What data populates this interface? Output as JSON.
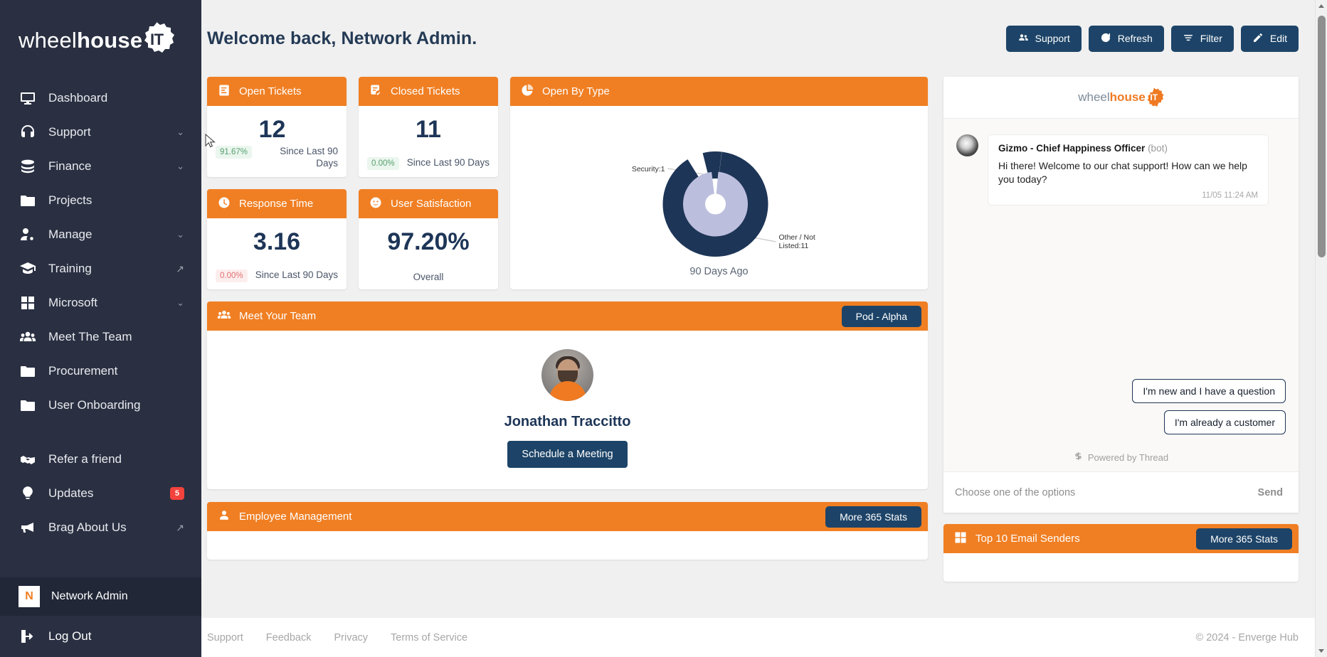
{
  "brand": {
    "light": "wheel",
    "bold": "house",
    "gear_text": "IT"
  },
  "sidebar": {
    "items": [
      {
        "label": "Dashboard",
        "icon": "monitor-icon",
        "trailing": ""
      },
      {
        "label": "Support",
        "icon": "headset-icon",
        "trailing": "chevron-down"
      },
      {
        "label": "Finance",
        "icon": "coins-icon",
        "trailing": "chevron-down"
      },
      {
        "label": "Projects",
        "icon": "folder-icon",
        "trailing": ""
      },
      {
        "label": "Manage",
        "icon": "user-gear-icon",
        "trailing": "chevron-down"
      },
      {
        "label": "Training",
        "icon": "graduation-cap-icon",
        "trailing": "external-link"
      },
      {
        "label": "Microsoft",
        "icon": "microsoft-icon",
        "trailing": "chevron-down"
      },
      {
        "label": "Meet The Team",
        "icon": "people-icon",
        "trailing": ""
      },
      {
        "label": "Procurement",
        "icon": "folder-icon",
        "trailing": ""
      },
      {
        "label": "User Onboarding",
        "icon": "folder-icon",
        "trailing": ""
      }
    ],
    "secondary": [
      {
        "label": "Refer a friend",
        "icon": "handshake-icon",
        "trailing": "",
        "badge": ""
      },
      {
        "label": "Updates",
        "icon": "lightbulb-icon",
        "trailing": "",
        "badge": "5"
      },
      {
        "label": "Brag About Us",
        "icon": "megaphone-icon",
        "trailing": "external-link",
        "badge": ""
      }
    ],
    "profile": {
      "initial": "N",
      "name": "Network Admin"
    },
    "logout": {
      "label": "Log Out",
      "icon": "logout-icon"
    }
  },
  "header": {
    "title": "Welcome back, Network Admin.",
    "buttons": [
      {
        "label": "Support",
        "icon": "people-icon"
      },
      {
        "label": "Refresh",
        "icon": "refresh-icon"
      },
      {
        "label": "Filter",
        "icon": "filter-icon"
      },
      {
        "label": "Edit",
        "icon": "pencil-icon"
      }
    ]
  },
  "kpis": {
    "open_tickets": {
      "title": "Open Tickets",
      "icon": "ticket-list-icon",
      "value": "12",
      "pill": "91.67%",
      "pill_kind": "up",
      "sub": "Since Last 90 Days"
    },
    "closed_tickets": {
      "title": "Closed Tickets",
      "icon": "ticket-check-icon",
      "value": "11",
      "pill": "0.00%",
      "pill_kind": "up",
      "sub": "Since Last 90 Days"
    },
    "response_time": {
      "title": "Response Time",
      "icon": "clock-icon",
      "value": "3.16",
      "pill": "0.00%",
      "pill_kind": "flat-red",
      "sub": "Since Last 90 Days"
    },
    "user_satisfaction": {
      "title": "User Satisfaction",
      "icon": "smiley-icon",
      "value": "97.20%",
      "sub": "Overall"
    }
  },
  "chart_data": {
    "type": "pie",
    "title": "Open By Type",
    "subtitle": "90 Days Ago",
    "labels": [
      "Security",
      "Other / Not Listed"
    ],
    "values": [
      1,
      11
    ],
    "annotations": [
      "Security:1",
      "Other / Not Listed:11"
    ],
    "colors": [
      "#1d3557",
      "#1d3557"
    ],
    "inner_ring_color": "#bcbedd",
    "legend": "none",
    "donut": true
  },
  "team": {
    "title": "Meet Your Team",
    "icon": "people-icon",
    "pod_button": "Pod - Alpha",
    "member_name": "Jonathan Traccitto",
    "schedule_button": "Schedule a Meeting"
  },
  "employee_card": {
    "title": "Employee Management",
    "icon": "person-icon",
    "button": "More 365 Stats"
  },
  "email_card": {
    "title": "Top 10 Email Senders",
    "icon": "microsoft-icon",
    "button": "More 365 Stats"
  },
  "chat": {
    "logo_light": "wheel",
    "logo_bold": "house",
    "logo_gear": "IT",
    "message": {
      "author": "Gizmo - Chief Happiness Officer",
      "role": "(bot)",
      "text": "Hi there! Welcome to our chat support! How can we help you today?",
      "timestamp": "11/05 11:24 AM"
    },
    "quick_replies": [
      "I'm new and I have a question",
      "I'm already a customer"
    ],
    "powered_by": "Powered by Thread",
    "input_placeholder": "Choose one of the options",
    "send_label": "Send"
  },
  "footer": {
    "links": [
      "Support",
      "Feedback",
      "Privacy",
      "Terms of Service"
    ],
    "copyright": "© 2024 - Enverge Hub"
  },
  "colors": {
    "accent_orange": "#f07f23",
    "navy": "#1d4468",
    "sidebar": "#2a3042",
    "chart_dark": "#1d3557",
    "chart_light": "#bcbedd"
  }
}
